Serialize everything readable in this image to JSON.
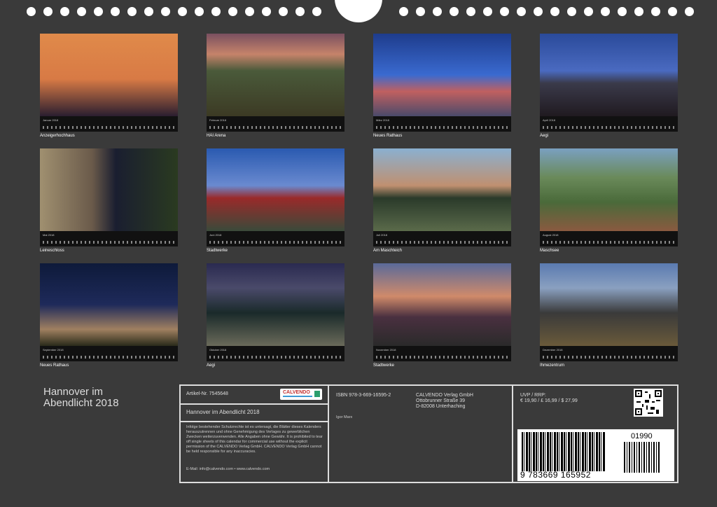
{
  "calendar_title": [
    "Hannover im",
    "Abendlicht 2018"
  ],
  "tiles": [
    {
      "caption": "Anzeigerhochhaus",
      "month": "Januar 2018"
    },
    {
      "caption": "HAI Arena",
      "month": "Februar 2018"
    },
    {
      "caption": "Neues Rathaus",
      "month": "März 2018"
    },
    {
      "caption": "Aegi",
      "month": "April 2018"
    },
    {
      "caption": "Leineschloss",
      "month": "Mai 2018"
    },
    {
      "caption": "Stadtwerke",
      "month": "Juni 2018"
    },
    {
      "caption": "Am Maschteich",
      "month": "Juli 2018"
    },
    {
      "caption": "Maschsee",
      "month": "August 2018"
    },
    {
      "caption": "Neues Rathaus",
      "month": "September 2018"
    },
    {
      "caption": "Aegi",
      "month": "Oktober 2018"
    },
    {
      "caption": "Stadtwerke",
      "month": "November 2018"
    },
    {
      "caption": "Ihmezentrum",
      "month": "Dezember 2018"
    }
  ],
  "info": {
    "artikel": "Artikel-Nr. 7545648",
    "logo_text": "CALVENDO",
    "product_title": "Hannover im Abendlicht 2018",
    "legal_text": "Infolge bestehender Schutzrechte ist es untersagt, die Blätter dieses Kalenders herauszutrennen und ohne Genehmigung des Verlages zu gewerblichen Zwecken weiterzuverwenden. Alle Angaben ohne Gewähr. It is prohibited to tear off single sheets of this calendar for commercial use without the explicit permission of the CALVENDO Verlag GmbH. CALVENDO Verlag GmbH cannot be held responsible for any inaccuracies.",
    "email": "E-Mail: info@calvendo.com • www.calvendo.com",
    "isbn": "ISBN 978-3-669-16595-2",
    "publisher": [
      "CALVENDO Verlag GmbH",
      "Ottobrunner Straße 39",
      "D-82008 Unterhaching"
    ],
    "author": "Igor Marx",
    "uvp_label": "UVP / RRP:",
    "prices": "€ 19,90 / £ 16,99 / $ 27,99",
    "ean": "9 783669 165952",
    "addon": "01990"
  }
}
